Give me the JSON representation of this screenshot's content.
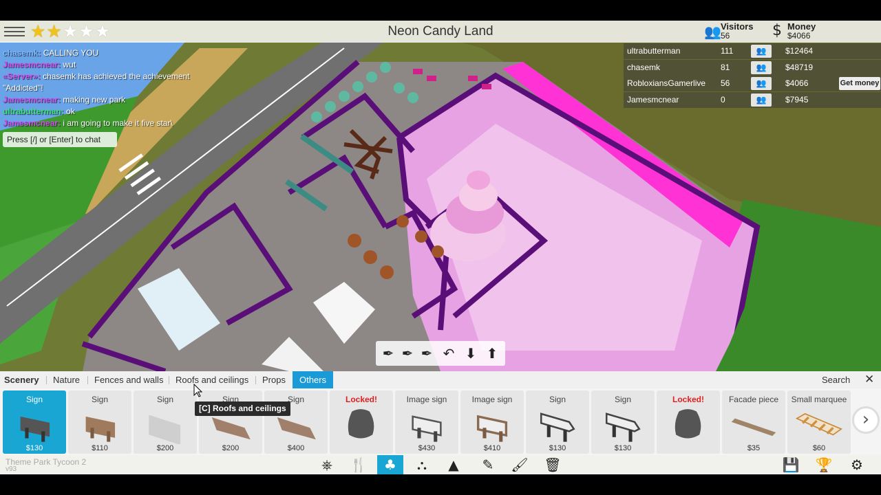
{
  "park": {
    "title": "Neon Candy Land",
    "rating_stars": 2,
    "max_stars": 5
  },
  "stats": {
    "visitors_label": "Visitors",
    "visitors_value": "56",
    "money_label": "Money",
    "money_value": "$4066"
  },
  "chat": {
    "messages": [
      {
        "name": "chasemk:",
        "text": "CALLING YOU",
        "color": "#7ab8ff"
      },
      {
        "name": "Jamesmcnear:",
        "text": "wut",
        "color": "#d04ef0"
      },
      {
        "name": "«Server»:",
        "text": "chasemk has achieved the achievement",
        "color": "#d04ef0"
      },
      {
        "name": "",
        "text": "\"Addicted\"!",
        "color": "#d04ef0"
      },
      {
        "name": "Jamesmcnear:",
        "text": "making new park",
        "color": "#d04ef0"
      },
      {
        "name": "ultrabutterman:",
        "text": "ok",
        "color": "#3fe07a"
      },
      {
        "name": "Jamesmcnear:",
        "text": "i am going to make it five star\\",
        "color": "#d04ef0"
      }
    ],
    "hint": "Press [/] or [Enter] to chat"
  },
  "players": [
    {
      "name": "ultrabutterman",
      "level": "111",
      "money": "$12464"
    },
    {
      "name": "chasemk",
      "level": "81",
      "money": "$48719"
    },
    {
      "name": "RobloxiansGamerlive",
      "level": "56",
      "money": "$4066"
    },
    {
      "name": "Jamesmcnear",
      "level": "0",
      "money": "$7945"
    }
  ],
  "get_money_label": "Get money",
  "tools": [
    {
      "icon": "rotate-left-icon",
      "glyph": "⟲"
    },
    {
      "icon": "place-single-icon",
      "glyph": "⬆"
    },
    {
      "icon": "place-multi-icon",
      "glyph": "⬆"
    },
    {
      "icon": "place-row-icon",
      "glyph": "⬆"
    },
    {
      "icon": "undo-icon",
      "glyph": "↶"
    },
    {
      "icon": "box-down-icon",
      "glyph": "⬇"
    },
    {
      "icon": "box-up-icon",
      "glyph": "⬆"
    }
  ],
  "tabs": {
    "scenery": "Scenery",
    "nature": "Nature",
    "fences": "Fences and walls",
    "roofs": "Roofs and ceilings",
    "props": "Props",
    "others": "Others",
    "search": "Search",
    "close": "✕"
  },
  "tooltip": "[C] Roofs and ceilings",
  "items": [
    {
      "title": "Sign",
      "price": "$130",
      "kind": "sign-dark",
      "selected": true,
      "locked": false
    },
    {
      "title": "Sign",
      "price": "$110",
      "kind": "sign-wood",
      "selected": false,
      "locked": false
    },
    {
      "title": "Sign",
      "price": "$200",
      "kind": "sign-flat",
      "selected": false,
      "locked": false
    },
    {
      "title": "Sign",
      "price": "$200",
      "kind": "sign-wood-tilt",
      "selected": false,
      "locked": false
    },
    {
      "title": "Sign",
      "price": "$400",
      "kind": "sign-wood-tilt",
      "selected": false,
      "locked": false
    },
    {
      "title": "Locked!",
      "price": "",
      "kind": "locked",
      "selected": false,
      "locked": true
    },
    {
      "title": "Image sign",
      "price": "$430",
      "kind": "image-sign",
      "selected": false,
      "locked": false
    },
    {
      "title": "Image sign",
      "price": "$410",
      "kind": "image-sign-wood",
      "selected": false,
      "locked": false
    },
    {
      "title": "Sign",
      "price": "$130",
      "kind": "sign-arrow",
      "selected": false,
      "locked": false
    },
    {
      "title": "Sign",
      "price": "$130",
      "kind": "sign-arrow",
      "selected": false,
      "locked": false
    },
    {
      "title": "Locked!",
      "price": "",
      "kind": "locked",
      "selected": false,
      "locked": true
    },
    {
      "title": "Facade piece",
      "price": "$35",
      "kind": "facade",
      "selected": false,
      "locked": false
    },
    {
      "title": "Small marquee",
      "price": "$60",
      "kind": "marquee",
      "selected": false,
      "locked": false
    }
  ],
  "bottom": {
    "game_name": "Theme Park Tycoon 2",
    "version": "v93",
    "left_icons": [
      "ferris-wheel-icon",
      "food-icon",
      "tree-icon",
      "path-icon",
      "tent-icon",
      "eyedropper-icon",
      "paintbrush-icon",
      "trash-icon"
    ],
    "right_icons": [
      "save-icon",
      "trophy-icon",
      "gear-icon"
    ]
  },
  "colors": {
    "accent": "#1a9bd8",
    "park_pink": "#e98de6",
    "park_purple": "#6a1a8a",
    "grass": "#3d8a2a"
  }
}
